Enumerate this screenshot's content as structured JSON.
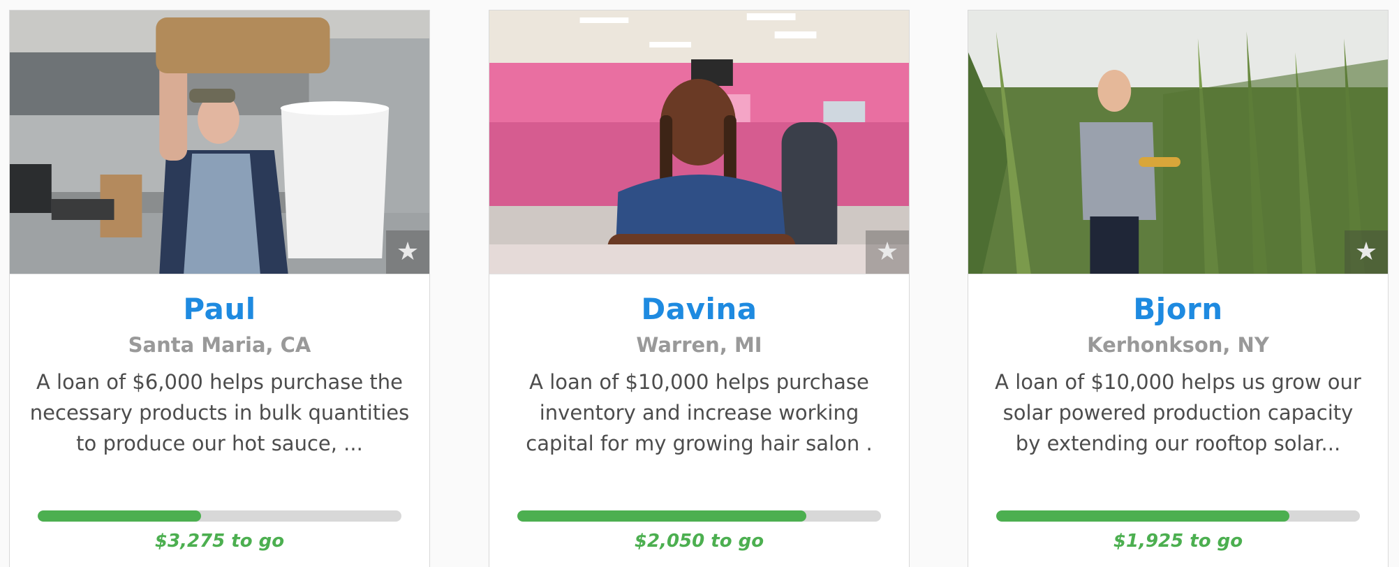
{
  "loans": [
    {
      "name": "Paul",
      "location": "Santa Maria, CA",
      "description": "A loan of $6,000 helps purchase the necessary products in bulk quantities to produce our hot sauce, ...",
      "progress_fraction": 0.45,
      "to_go": "$3,275 to go",
      "favorite_icon": "star-icon"
    },
    {
      "name": "Davina",
      "location": "Warren, MI",
      "description": "A loan of $10,000 helps purchase inventory and increase working capital for my growing hair salon .",
      "progress_fraction": 0.795,
      "to_go": "$2,050 to go",
      "favorite_icon": "star-icon"
    },
    {
      "name": "Bjorn",
      "location": "Kerhonkson, NY",
      "description": "A loan of $10,000 helps us grow our solar powered production capacity by extending our rooftop solar...",
      "progress_fraction": 0.807,
      "to_go": "$1,925 to go",
      "favorite_icon": "star-icon"
    }
  ],
  "colors": {
    "name": "#1e8ae0",
    "location": "#999999",
    "progress_fill": "#4caf50",
    "progress_track": "#d8d8d8"
  }
}
